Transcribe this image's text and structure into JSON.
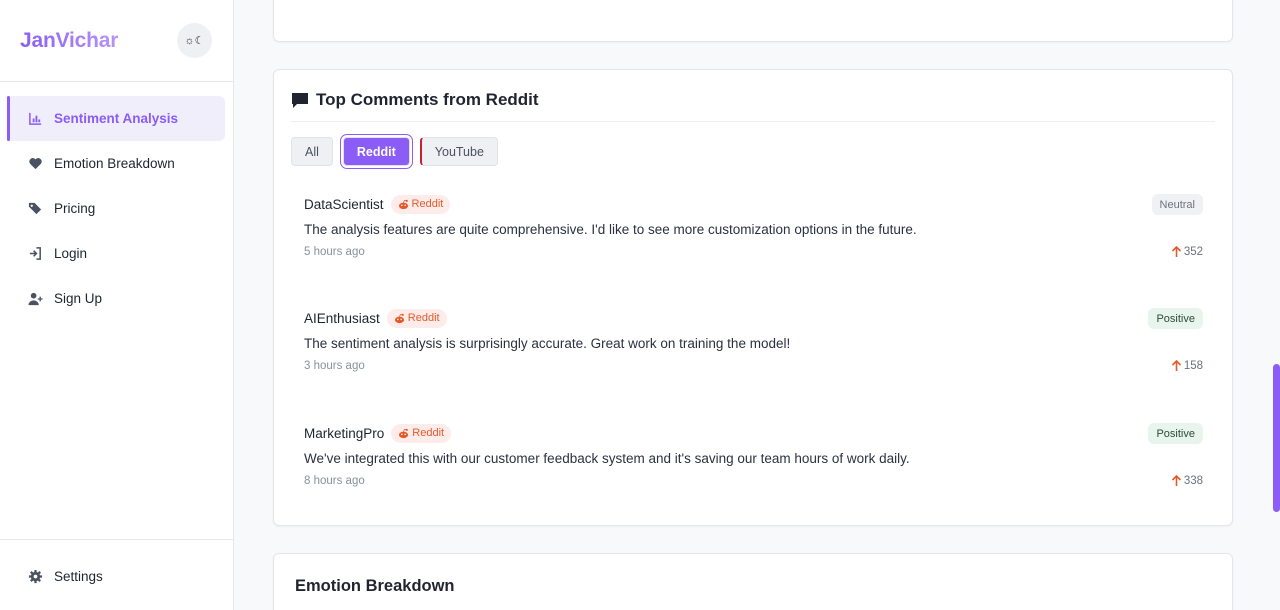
{
  "app": {
    "brand": "JanVichar",
    "theme_toggle_label": "☼☾"
  },
  "sidebar": {
    "items": [
      {
        "label": "Sentiment Analysis",
        "icon": "chart-icon",
        "active": true
      },
      {
        "label": "Emotion Breakdown",
        "icon": "heart-icon"
      },
      {
        "label": "Pricing",
        "icon": "tags-icon"
      },
      {
        "label": "Login",
        "icon": "login-icon"
      },
      {
        "label": "Sign Up",
        "icon": "user-plus-icon"
      }
    ],
    "settings": {
      "label": "Settings",
      "icon": "gear-icon"
    }
  },
  "comments_card": {
    "title": "Top Comments from Reddit",
    "filters": [
      "All",
      "Reddit",
      "YouTube"
    ],
    "active_filter": "Reddit",
    "comments": [
      {
        "author": "DataScientist",
        "source": "Reddit",
        "sentiment": "Neutral",
        "text": "The analysis features are quite comprehensive. I'd like to see more customization options in the future.",
        "time": "5 hours ago",
        "votes": "352"
      },
      {
        "author": "AIEnthusiast",
        "source": "Reddit",
        "sentiment": "Positive",
        "text": "The sentiment analysis is surprisingly accurate. Great work on training the model!",
        "time": "3 hours ago",
        "votes": "158"
      },
      {
        "author": "MarketingPro",
        "source": "Reddit",
        "sentiment": "Positive",
        "text": "We've integrated this with our customer feedback system and it's saving our team hours of work daily.",
        "time": "8 hours ago",
        "votes": "338"
      }
    ]
  },
  "emotion_card": {
    "title": "Emotion Breakdown"
  },
  "colors": {
    "accent": "#8b5cf6",
    "reddit": "#e35b2a",
    "upvote": "#e35b2a"
  }
}
